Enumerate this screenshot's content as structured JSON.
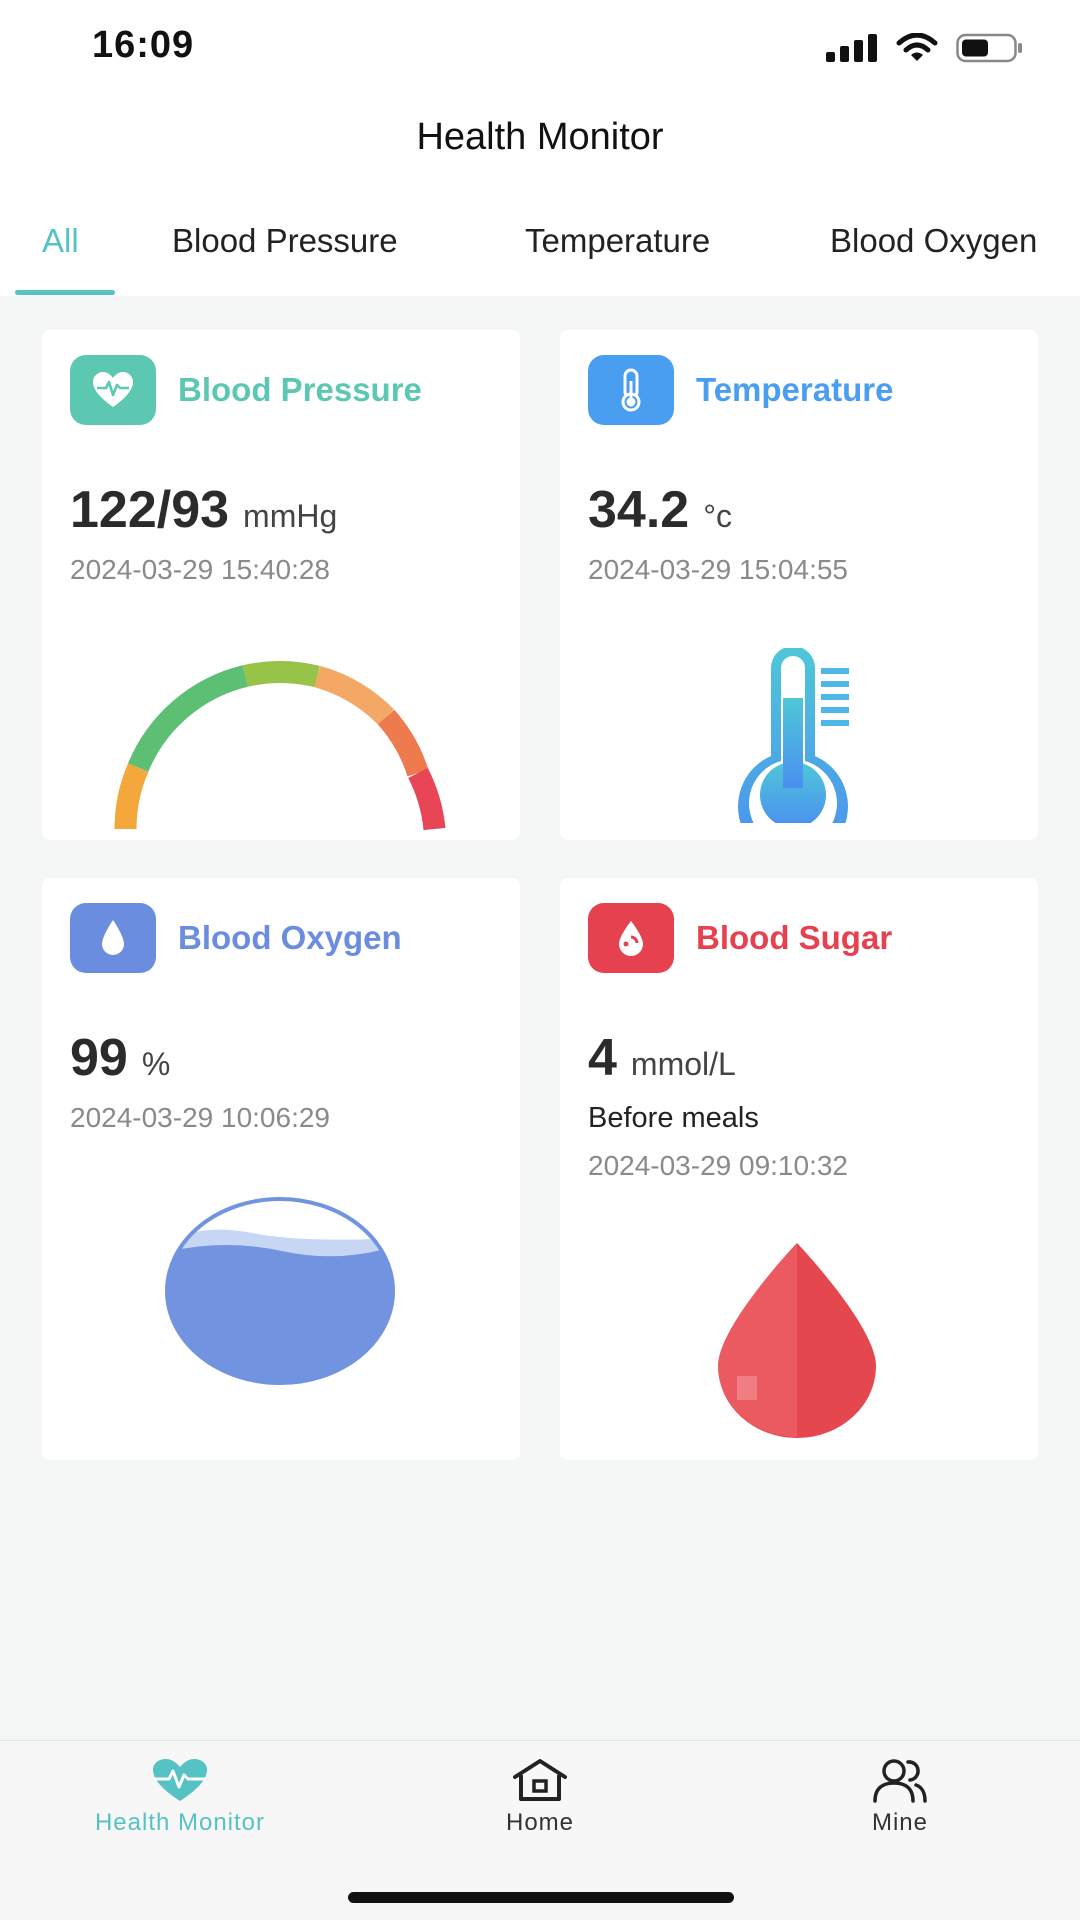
{
  "status_bar": {
    "time": "16:09"
  },
  "header": {
    "title": "Health Monitor"
  },
  "tabs": [
    {
      "label": "All",
      "active": true
    },
    {
      "label": "Blood Pressure",
      "active": false
    },
    {
      "label": "Temperature",
      "active": false
    },
    {
      "label": "Blood Oxygen",
      "active": false
    }
  ],
  "cards": {
    "blood_pressure": {
      "title": "Blood Pressure",
      "value": "122/93",
      "unit": "mmHg",
      "timestamp": "2024-03-29 15:40:28",
      "icon": "heart-pulse-icon",
      "color": "#5cc8b2"
    },
    "temperature": {
      "title": "Temperature",
      "value": "34.2",
      "unit": "°c",
      "timestamp": "2024-03-29 15:04:55",
      "icon": "thermometer-icon",
      "color": "#4a9ef0"
    },
    "blood_oxygen": {
      "title": "Blood Oxygen",
      "value": "99",
      "unit": "%",
      "timestamp": "2024-03-29 10:06:29",
      "icon": "water-drop-icon",
      "color": "#6a8de0"
    },
    "blood_sugar": {
      "title": "Blood Sugar",
      "value": "4",
      "unit": "mmol/L",
      "note": "Before meals",
      "timestamp": "2024-03-29 09:10:32",
      "icon": "blood-drop-icon",
      "color": "#e5414f"
    }
  },
  "bottom_nav": [
    {
      "label": "Health Monitor",
      "icon": "heart-pulse-icon",
      "active": true
    },
    {
      "label": "Home",
      "icon": "home-icon",
      "active": false
    },
    {
      "label": "Mine",
      "icon": "users-icon",
      "active": false
    }
  ],
  "colors": {
    "accent": "#56c2c3"
  }
}
